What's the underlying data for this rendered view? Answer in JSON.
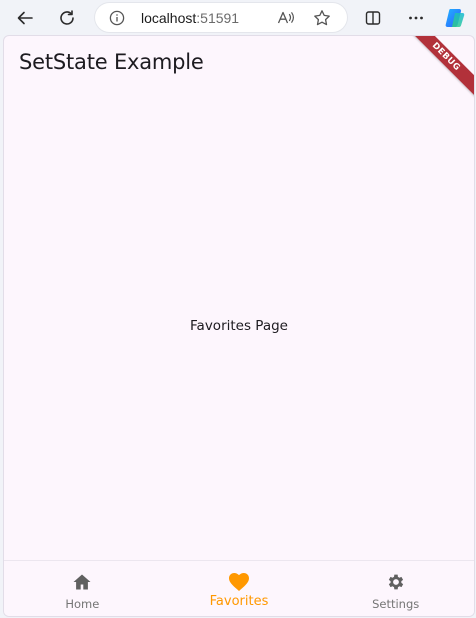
{
  "browser": {
    "address_host": "localhost",
    "address_port": ":51591",
    "read_aloud_glyph": "A⁾"
  },
  "app": {
    "title": "SetState Example",
    "debug_banner": "DEBUG",
    "page_text": "Favorites Page"
  },
  "bottom_nav": {
    "items": [
      {
        "label": "Home",
        "icon": "home-icon"
      },
      {
        "label": "Favorites",
        "icon": "heart-icon"
      },
      {
        "label": "Settings",
        "icon": "gear-icon"
      }
    ],
    "selected_index": 1,
    "active_color": "#ff9800",
    "inactive_color": "#757575"
  }
}
